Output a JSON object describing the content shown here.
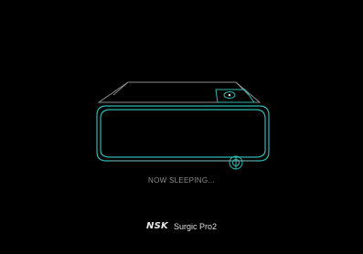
{
  "screen": {
    "status_text": "NOW SLEEPING...",
    "brand": {
      "logo": "NSK",
      "model": "Surgic Pro2"
    }
  },
  "icons": {
    "device": "surgical-motor-unit-icon",
    "power_button": "power-button-icon",
    "knob": "control-knob-icon"
  },
  "colors": {
    "background": "#000000",
    "device_outline": "#2fb7b0",
    "device_outline_dim": "#8a8a8a",
    "status_text": "#8a8a8a",
    "brand_text": "#e8e8e8"
  }
}
